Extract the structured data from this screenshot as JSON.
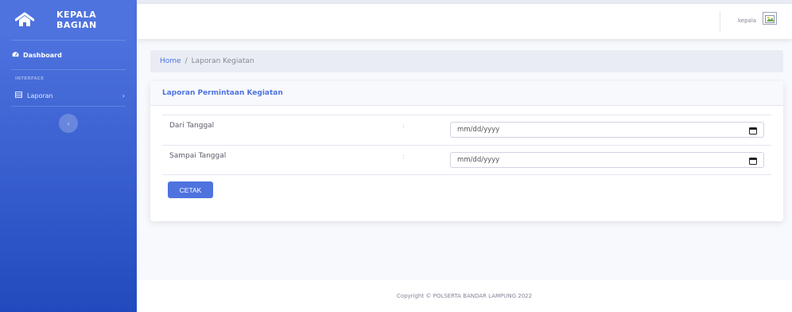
{
  "sidebar": {
    "brand_line1": "KEPALA",
    "brand_line2": "BAGIAN",
    "dashboard_label": "Dashboard",
    "heading": "INTERFACE",
    "laporan_label": "Laporan",
    "toggle_icon": "chevron-left-icon"
  },
  "topbar": {
    "user_name": "kepala"
  },
  "breadcrumb": {
    "home": "Home",
    "separator": "/",
    "current": "Laporan Kegiatan"
  },
  "card": {
    "title": "Laporan Permintaan Kegiatan",
    "fields": [
      {
        "label": "Dari Tanggal",
        "colon": ":",
        "placeholder": "mm/dd/yyyy"
      },
      {
        "label": "Sampai Tanggal",
        "colon": ":",
        "placeholder": "mm/dd/yyyy"
      }
    ],
    "button_label": "CETAK"
  },
  "footer": {
    "text": "Copyright © POLSERTA BANDAR LAMPUNG 2022"
  },
  "colors": {
    "primary": "#4e73df",
    "sidebar_dark": "#224abe",
    "text_muted": "#858796",
    "background": "#f8f9fc"
  }
}
